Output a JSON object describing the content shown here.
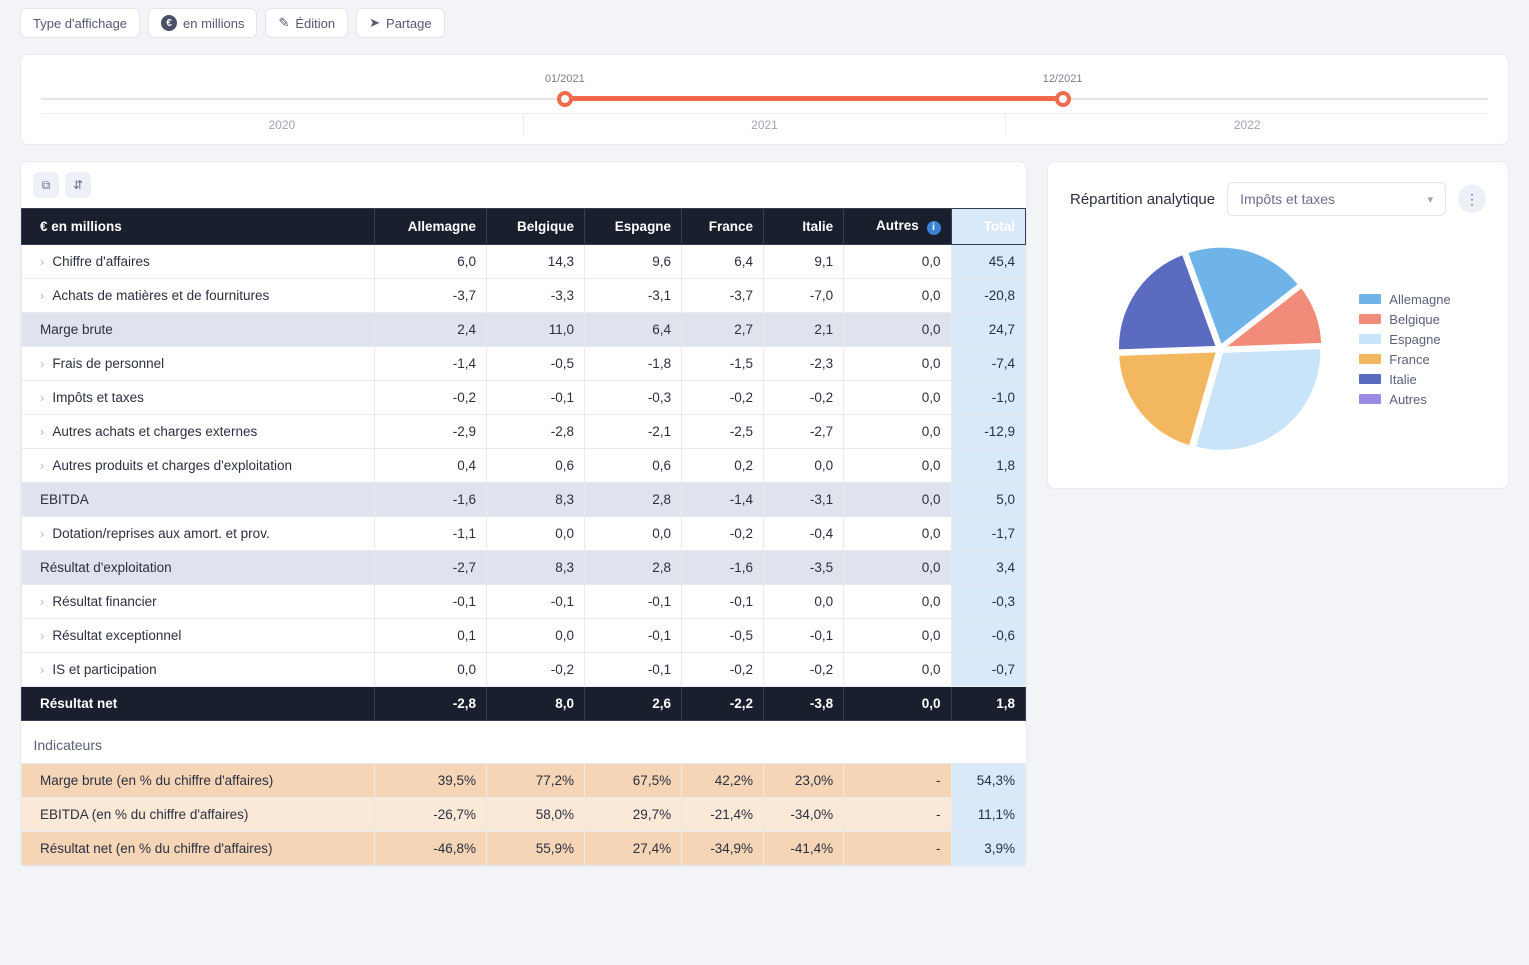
{
  "toolbar": {
    "display_type": "Type d'affichage",
    "unit": "en millions",
    "edition": "Édition",
    "share": "Partage"
  },
  "timeline": {
    "start_label": "01/2021",
    "end_label": "12/2021",
    "years": [
      "2020",
      "2021",
      "2022"
    ],
    "start_pct": 36.2,
    "end_pct": 70.6
  },
  "table": {
    "unit_header": "€ en millions",
    "columns": [
      "Allemagne",
      "Belgique",
      "Espagne",
      "France",
      "Italie",
      "Autres",
      "Total"
    ],
    "rows": [
      {
        "type": "expand",
        "label": "Chiffre d'affaires",
        "v": [
          "6,0",
          "14,3",
          "9,6",
          "6,4",
          "9,1",
          "0,0",
          "45,4"
        ]
      },
      {
        "type": "expand",
        "label": "Achats de matières et de fournitures",
        "v": [
          "-3,7",
          "-3,3",
          "-3,1",
          "-3,7",
          "-7,0",
          "0,0",
          "-20,8"
        ]
      },
      {
        "type": "sub",
        "label": "Marge brute",
        "v": [
          "2,4",
          "11,0",
          "6,4",
          "2,7",
          "2,1",
          "0,0",
          "24,7"
        ]
      },
      {
        "type": "expand",
        "label": "Frais de personnel",
        "v": [
          "-1,4",
          "-0,5",
          "-1,8",
          "-1,5",
          "-2,3",
          "0,0",
          "-7,4"
        ]
      },
      {
        "type": "expand",
        "label": "Impôts et taxes",
        "v": [
          "-0,2",
          "-0,1",
          "-0,3",
          "-0,2",
          "-0,2",
          "0,0",
          "-1,0"
        ]
      },
      {
        "type": "expand",
        "label": "Autres achats et charges externes",
        "v": [
          "-2,9",
          "-2,8",
          "-2,1",
          "-2,5",
          "-2,7",
          "0,0",
          "-12,9"
        ]
      },
      {
        "type": "expand",
        "label": "Autres produits et charges d'exploitation",
        "v": [
          "0,4",
          "0,6",
          "0,6",
          "0,2",
          "0,0",
          "0,0",
          "1,8"
        ]
      },
      {
        "type": "sub",
        "label": "EBITDA",
        "v": [
          "-1,6",
          "8,3",
          "2,8",
          "-1,4",
          "-3,1",
          "0,0",
          "5,0"
        ]
      },
      {
        "type": "expand",
        "label": "Dotation/reprises aux amort. et prov.",
        "v": [
          "-1,1",
          "0,0",
          "0,0",
          "-0,2",
          "-0,4",
          "0,0",
          "-1,7"
        ]
      },
      {
        "type": "sub",
        "label": "Résultat d'exploitation",
        "v": [
          "-2,7",
          "8,3",
          "2,8",
          "-1,6",
          "-3,5",
          "0,0",
          "3,4"
        ]
      },
      {
        "type": "expand",
        "label": "Résultat financier",
        "v": [
          "-0,1",
          "-0,1",
          "-0,1",
          "-0,1",
          "0,0",
          "0,0",
          "-0,3"
        ]
      },
      {
        "type": "expand",
        "label": "Résultat exceptionnel",
        "v": [
          "0,1",
          "0,0",
          "-0,1",
          "-0,5",
          "-0,1",
          "0,0",
          "-0,6"
        ]
      },
      {
        "type": "expand",
        "label": "IS et participation",
        "v": [
          "0,0",
          "-0,2",
          "-0,1",
          "-0,2",
          "-0,2",
          "0,0",
          "-0,7"
        ]
      },
      {
        "type": "final",
        "label": "Résultat net",
        "v": [
          "-2,8",
          "8,0",
          "2,6",
          "-2,2",
          "-3,8",
          "0,0",
          "1,8"
        ]
      }
    ],
    "indicators_title": "Indicateurs",
    "indicators": [
      {
        "shade": "dark",
        "label": "Marge brute (en % du chiffre d'affaires)",
        "v": [
          "39,5%",
          "77,2%",
          "67,5%",
          "42,2%",
          "23,0%",
          "-",
          "54,3%"
        ]
      },
      {
        "shade": "light",
        "label": "EBITDA (en % du chiffre d'affaires)",
        "v": [
          "-26,7%",
          "58,0%",
          "29,7%",
          "-21,4%",
          "-34,0%",
          "-",
          "11,1%"
        ]
      },
      {
        "shade": "dark",
        "label": "Résultat net (en % du chiffre d'affaires)",
        "v": [
          "-46,8%",
          "55,9%",
          "27,4%",
          "-34,9%",
          "-41,4%",
          "-",
          "3,9%"
        ]
      }
    ]
  },
  "chart": {
    "title": "Répartition analytique",
    "selected": "Impôts et taxes",
    "legend": [
      "Allemagne",
      "Belgique",
      "Espagne",
      "France",
      "Italie",
      "Autres"
    ],
    "colors": [
      "#6fb4e8",
      "#f28c7a",
      "#c9e3f8",
      "#f2b75f",
      "#5b6bbf",
      "#9b8ae2"
    ]
  },
  "chart_data": {
    "type": "pie",
    "title": "Répartition analytique — Impôts et taxes",
    "series": [
      {
        "name": "Allemagne",
        "value": 0.2,
        "color": "#6fb4e8"
      },
      {
        "name": "Belgique",
        "value": 0.1,
        "color": "#f28c7a"
      },
      {
        "name": "Espagne",
        "value": 0.3,
        "color": "#c9e3f8"
      },
      {
        "name": "France",
        "value": 0.2,
        "color": "#f2b75f"
      },
      {
        "name": "Italie",
        "value": 0.2,
        "color": "#5b6bbf"
      },
      {
        "name": "Autres",
        "value": 0.0,
        "color": "#9b8ae2"
      }
    ]
  }
}
